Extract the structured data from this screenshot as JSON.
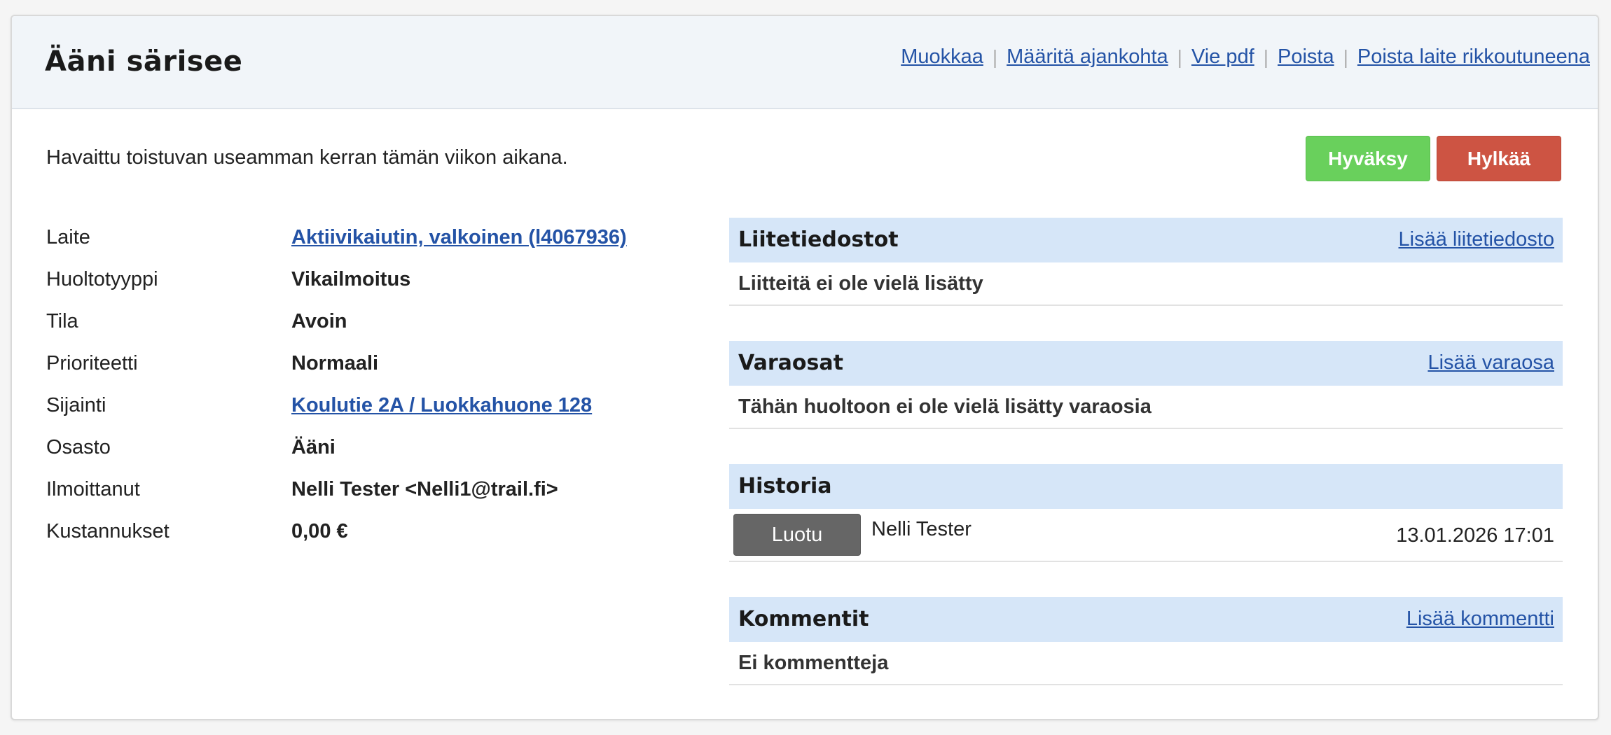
{
  "header": {
    "title": "Ääni särisee",
    "actions": [
      {
        "label": "Muokkaa"
      },
      {
        "label": "Määritä ajankohta"
      },
      {
        "label": "Vie pdf"
      },
      {
        "label": "Poista"
      },
      {
        "label": "Poista laite rikkoutuneena"
      }
    ],
    "separator": "|"
  },
  "description": "Havaittu toistuvan useamman kerran tämän viikon aikana.",
  "buttons": {
    "approve": "Hyväksy",
    "reject": "Hylkää"
  },
  "details": [
    {
      "label": "Laite",
      "value": "Aktiivikaiutin, valkoinen (l4067936)",
      "link": true
    },
    {
      "label": "Huoltotyyppi",
      "value": "Vikailmoitus",
      "link": false
    },
    {
      "label": "Tila",
      "value": "Avoin",
      "link": false
    },
    {
      "label": "Prioriteetti",
      "value": "Normaali",
      "link": false
    },
    {
      "label": "Sijainti",
      "value": "Koulutie 2A / Luokkahuone 128",
      "link": true
    },
    {
      "label": "Osasto",
      "value": "Ääni",
      "link": false
    },
    {
      "label": "Ilmoittanut",
      "value": "Nelli Tester <Nelli1@trail.fi>",
      "link": false
    },
    {
      "label": "Kustannukset",
      "value": "0,00 €",
      "link": false
    }
  ],
  "attachments": {
    "title": "Liitetiedostot",
    "action": "Lisää liitetiedosto",
    "empty": "Liitteitä ei ole vielä lisätty"
  },
  "spare_parts": {
    "title": "Varaosat",
    "action": "Lisää varaosa",
    "empty": "Tähän huoltoon ei ole vielä lisätty varaosia"
  },
  "history": {
    "title": "Historia",
    "entries": [
      {
        "event": "Luotu",
        "user": "Nelli Tester",
        "time": "13.01.2026 17:01"
      }
    ]
  },
  "comments": {
    "title": "Kommentit",
    "action": "Lisää kommentti",
    "empty": "Ei kommentteja"
  },
  "colors": {
    "approve": "#69d05c",
    "reject": "#cd5443",
    "link": "#2453a6",
    "panel_header": "#d6e6f8",
    "history_badge": "#666666"
  }
}
